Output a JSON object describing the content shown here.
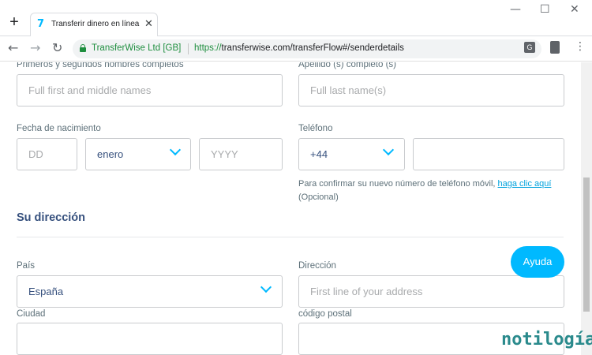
{
  "browser": {
    "tab_title": "Transferir dinero en línea",
    "tab_favicon": "7",
    "new_tab": "+",
    "close_tab": "✕",
    "window_controls": {
      "minimize": "—",
      "maximize": "☐",
      "close": "✕"
    },
    "back": "←",
    "forward": "→",
    "reload": "↻",
    "site_name": "TransferWise Ltd [GB]",
    "url_scheme": "https://",
    "url_rest": "transferwise.com/transferFlow#/senderdetails",
    "menu": "⋮",
    "translate_glyph": "G"
  },
  "form": {
    "first_names": {
      "label": "Primeros y segundos nombres completos",
      "placeholder": "Full first and middle names"
    },
    "last_name": {
      "label": "Apellido (s) completo (s)",
      "placeholder": "Full last name(s)"
    },
    "birth_date": {
      "label": "Fecha de nacimiento",
      "day_placeholder": "DD",
      "month_value": "enero",
      "year_placeholder": "YYYY"
    },
    "phone": {
      "label": "Teléfono",
      "country_code": "+44",
      "number_placeholder": ""
    },
    "phone_hint": {
      "text_before": "Para confirmar su nuevo número de teléfono móvil, ",
      "link": "haga clic aquí ",
      "text_after": "(Opcional)"
    },
    "address_section_title": "Su dirección",
    "country": {
      "label": "País",
      "value": "España"
    },
    "address": {
      "label": "Dirección",
      "placeholder": "First line of your address"
    },
    "city": {
      "label": "Ciudad"
    },
    "postal_code": {
      "label": "código postal"
    }
  },
  "help_button": "Ayuda",
  "watermark": "notilogía",
  "colors": {
    "accent": "#00b9ff",
    "text": "#37517e",
    "secure": "#1e8e3e",
    "watermark": "#2a8a8c"
  },
  "icons": [
    "transferwise-logo-icon",
    "lock-icon",
    "translate-icon",
    "clipboard-icon",
    "menu-icon",
    "chevron-down-icon"
  ]
}
